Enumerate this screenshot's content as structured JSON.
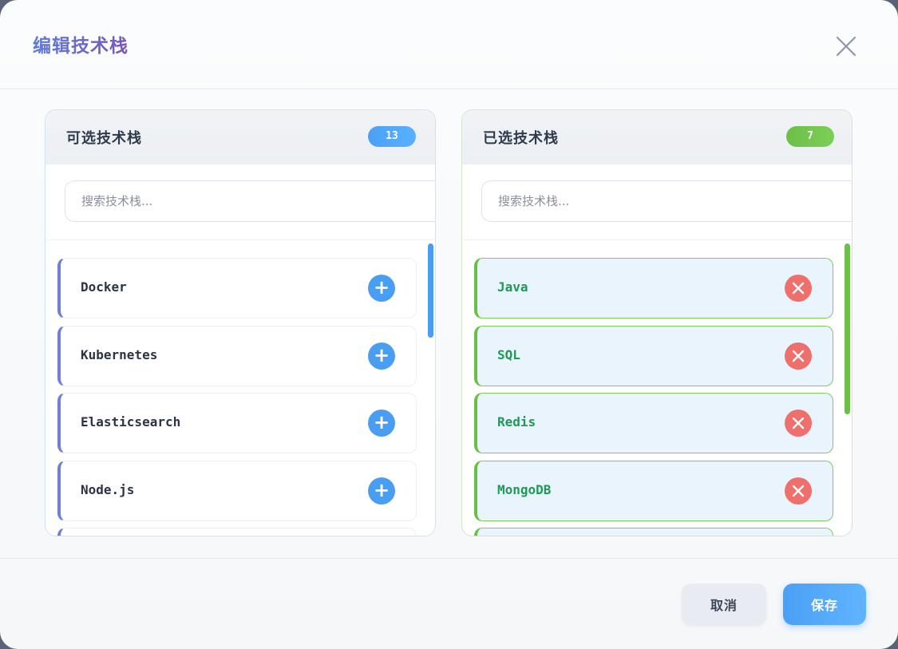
{
  "dialog": {
    "title": "编辑技术栈",
    "close_icon": "close-icon"
  },
  "available": {
    "title": "可选技术栈",
    "count": "13",
    "search_placeholder": "搜索技术栈...",
    "items": [
      {
        "label": "Docker"
      },
      {
        "label": "Kubernetes"
      },
      {
        "label": "Elasticsearch"
      },
      {
        "label": "Node.js"
      }
    ],
    "accent": "#4a9ef2"
  },
  "selected": {
    "title": "已选技术栈",
    "count": "7",
    "search_placeholder": "搜索技术栈...",
    "items": [
      {
        "label": "Java"
      },
      {
        "label": "SQL"
      },
      {
        "label": "Redis"
      },
      {
        "label": "MongoDB"
      }
    ],
    "accent": "#6cc04a"
  },
  "footer": {
    "cancel_label": "取消",
    "save_label": "保存"
  }
}
